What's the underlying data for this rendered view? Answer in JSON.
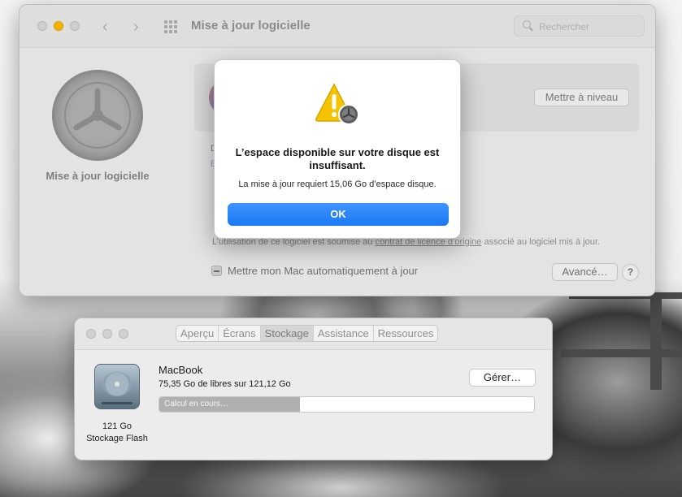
{
  "preferences_window": {
    "title": "Mise à jour logicielle",
    "search_placeholder": "Rechercher",
    "sidebar_label": "Mise à jour logicielle",
    "upgrade_button": "Mettre à niveau",
    "partial_text_1": "D",
    "partial_text_2": "E",
    "license_prefix": "L’utilisation de ce logiciel est soumise au ",
    "license_link": "contrat de licence d’origine",
    "license_suffix": " associé au logiciel mis à jour.",
    "auto_update_label": "Mettre mon Mac automatiquement à jour",
    "advanced_button": "Avancé…",
    "help_button": "?"
  },
  "alert": {
    "title": "L’espace disponible sur votre disque est insuffisant.",
    "message": "La mise à jour requiert 15,06 Go d’espace disque.",
    "ok_button": "OK",
    "icon": "warning-gear-icon"
  },
  "about_window": {
    "tabs": [
      {
        "label": "Aperçu",
        "selected": false
      },
      {
        "label": "Écrans",
        "selected": false
      },
      {
        "label": "Stockage",
        "selected": true
      },
      {
        "label": "Assistance",
        "selected": false
      },
      {
        "label": "Ressources",
        "selected": false
      }
    ],
    "drive_size": "121 Go",
    "drive_type": "Stockage Flash",
    "disk_name": "MacBook",
    "disk_free": "75,35 Go de libres sur 121,12 Go",
    "manage_button": "Gérer…",
    "progress_label": "Calcul en cours…",
    "progress_fraction": 0.375
  },
  "colors": {
    "accent": "#1b79f5",
    "window_bg": "#e3e3e3",
    "traffic_yellow": "#f5b100"
  }
}
